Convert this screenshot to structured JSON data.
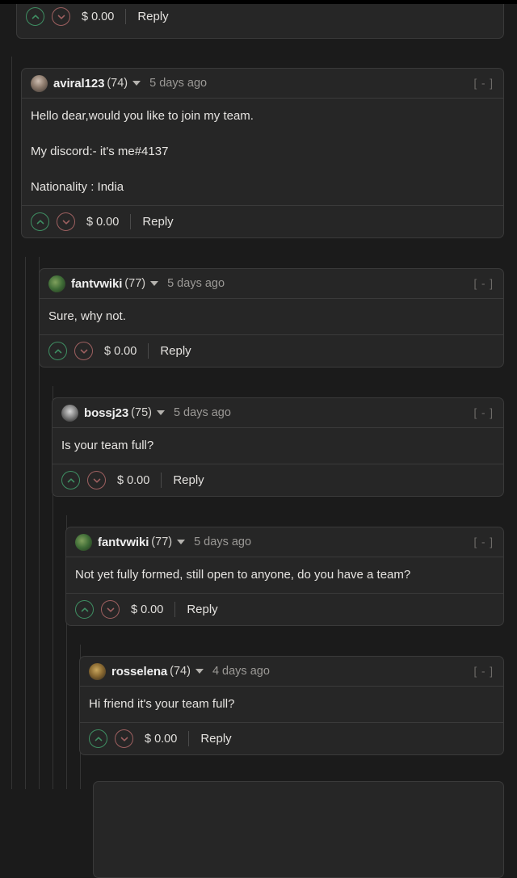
{
  "theme": {
    "page_bg": "#1b1b1b",
    "card_bg": "#262626",
    "card_border": "#3a3a3a",
    "upvote_color": "#3f8f63",
    "downvote_color": "#9e6060",
    "text_color": "#e6e4e1",
    "muted_text": "#9b9996"
  },
  "common": {
    "payout": "$ 0.00",
    "reply_label": "Reply",
    "collapse_label": "[ - ]",
    "upvote_icon": "chevron-up-circle-icon",
    "downvote_icon": "chevron-down-circle-icon",
    "caret_icon": "caret-down-icon"
  },
  "comments": [
    {
      "id": "partial-top",
      "partial": true,
      "payout": "$ 0.00",
      "reply_label": "Reply"
    },
    {
      "id": "aviral123",
      "username": "aviral123",
      "reputation": "(74)",
      "timestamp": "5 days ago",
      "collapse_label": "[ - ]",
      "avatar_class": "av-aviral",
      "body": [
        "Hello dear,would you like to join my team.",
        "My discord:- it's me#4137",
        "Nationality : India"
      ],
      "payout": "$ 0.00",
      "reply_label": "Reply"
    },
    {
      "id": "fantvwiki-1",
      "username": "fantvwiki",
      "reputation": "(77)",
      "timestamp": "5 days ago",
      "collapse_label": "[ - ]",
      "avatar_class": "av-fantvwiki",
      "body": [
        "Sure, why not."
      ],
      "payout": "$ 0.00",
      "reply_label": "Reply"
    },
    {
      "id": "bossj23",
      "username": "bossj23",
      "reputation": "(75)",
      "timestamp": "5 days ago",
      "collapse_label": "[ - ]",
      "avatar_class": "av-bossj23",
      "body": [
        "Is your team full?"
      ],
      "payout": "$ 0.00",
      "reply_label": "Reply"
    },
    {
      "id": "fantvwiki-2",
      "username": "fantvwiki",
      "reputation": "(77)",
      "timestamp": "5 days ago",
      "collapse_label": "[ - ]",
      "avatar_class": "av-fantvwiki",
      "body": [
        "Not yet fully formed, still open to anyone, do you have a team?"
      ],
      "payout": "$ 0.00",
      "reply_label": "Reply"
    },
    {
      "id": "rosselena",
      "username": "rosselena",
      "reputation": "(74)",
      "timestamp": "4 days ago",
      "collapse_label": "[ - ]",
      "avatar_class": "av-rosselena",
      "body": [
        "Hi friend it's your team full?"
      ],
      "payout": "$ 0.00",
      "reply_label": "Reply"
    }
  ]
}
